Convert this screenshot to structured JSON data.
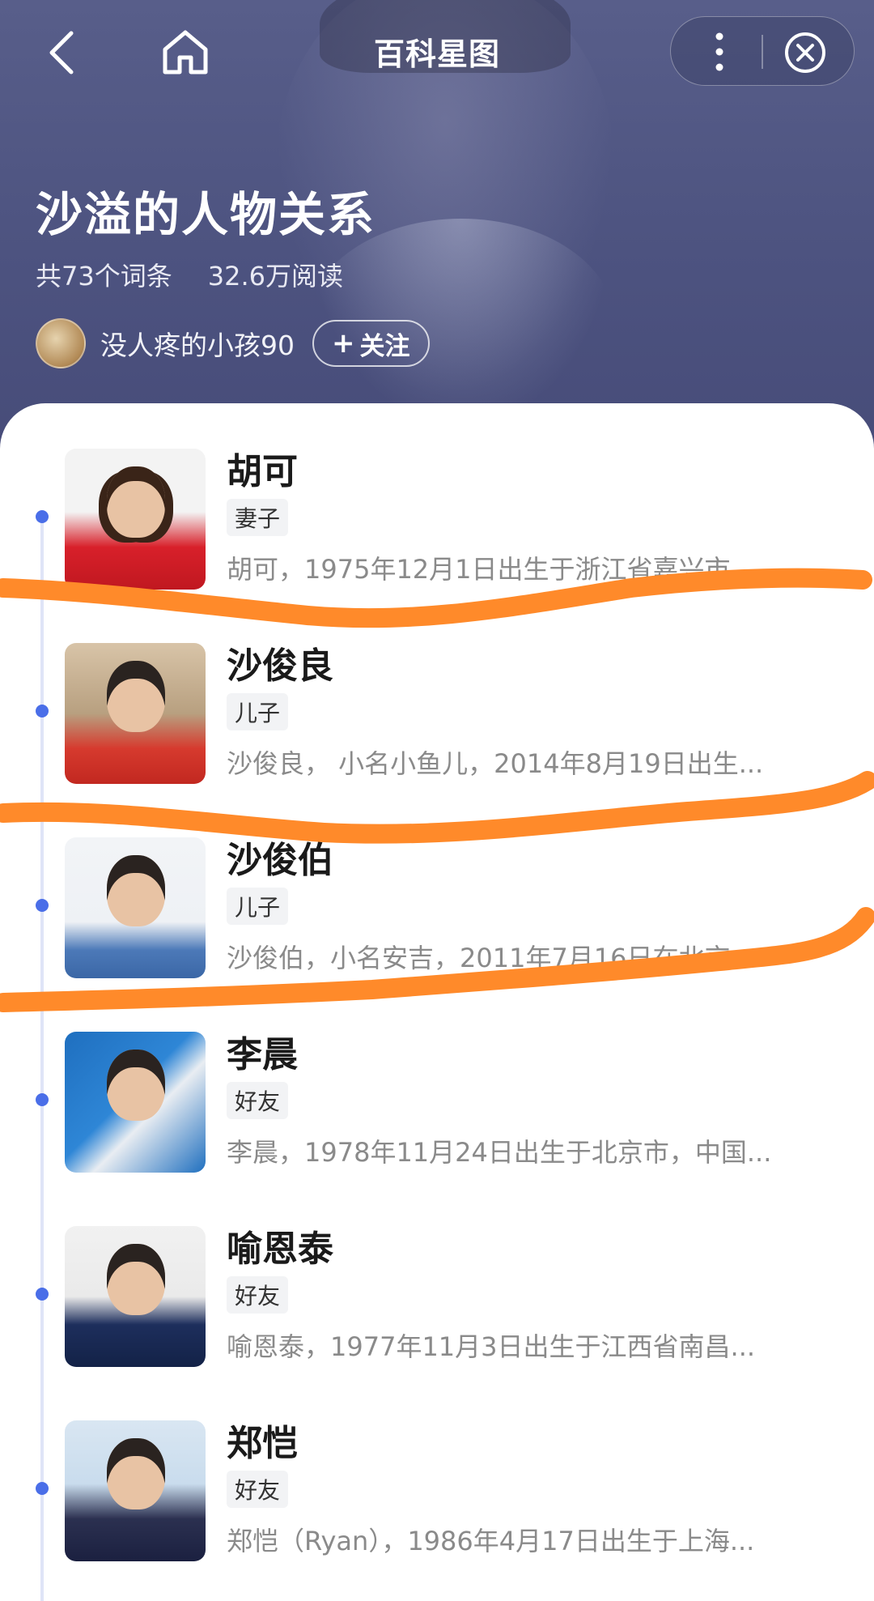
{
  "header": {
    "nav_title": "百科星图",
    "page_title": "沙溢的人物关系",
    "entry_count": "共73个词条",
    "read_count": "32.6万阅读",
    "author_name": "没人疼的小孩90",
    "follow_label": "关注",
    "follow_plus": "+"
  },
  "icons": {
    "back": "chevron-left-icon",
    "home": "home-icon",
    "more": "more-vertical-icon",
    "close": "close-circle-icon"
  },
  "colors": {
    "header_bg": "#4f5582",
    "timeline_dot": "#4a6ee8",
    "marker_stroke": "#ff8a2a"
  },
  "entries": [
    {
      "name": "胡可",
      "relation": "妻子",
      "description": "胡可，1975年12月1日出生于浙江省嘉兴市..."
    },
    {
      "name": "沙俊良",
      "relation": "儿子",
      "description": "沙俊良， 小名小鱼儿，2014年8月19日出生..."
    },
    {
      "name": "沙俊伯",
      "relation": "儿子",
      "description": "沙俊伯，小名安吉，2011年7月16日在北京..."
    },
    {
      "name": "李晨",
      "relation": "好友",
      "description": "李晨，1978年11月24日出生于北京市，中国..."
    },
    {
      "name": "喻恩泰",
      "relation": "好友",
      "description": "喻恩泰，1977年11月3日出生于江西省南昌..."
    },
    {
      "name": "郑恺",
      "relation": "好友",
      "description": "郑恺（Ryan），1986年4月17日出生于上海..."
    }
  ]
}
